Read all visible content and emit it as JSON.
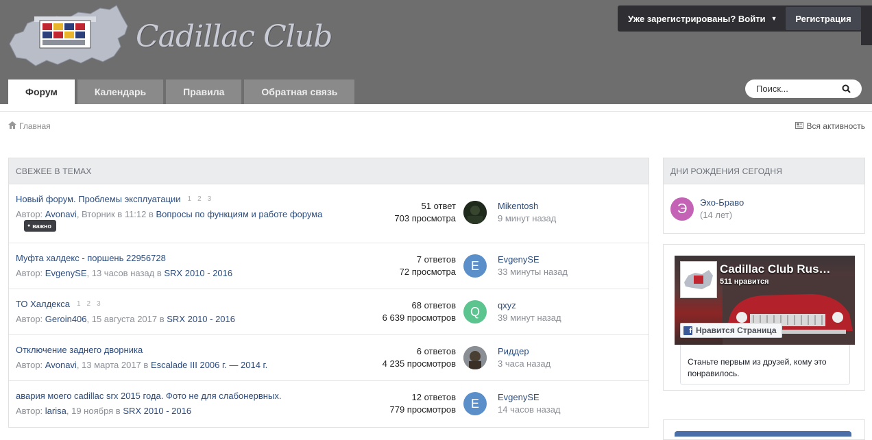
{
  "header": {
    "logo_text": "Cadillac Club",
    "login_label": "Уже зарегистрированы? Войти",
    "register_label": "Регистрация",
    "search_placeholder": "Поиск..."
  },
  "nav": {
    "tabs": [
      {
        "label": "Форум",
        "active": true
      },
      {
        "label": "Календарь",
        "active": false
      },
      {
        "label": "Правила",
        "active": false
      },
      {
        "label": "Обратная связь",
        "active": false
      }
    ]
  },
  "breadcrumb": {
    "home_label": "Главная",
    "activity_label": "Вся активность"
  },
  "topics": {
    "header": "СВЕЖЕЕ В ТЕМАХ",
    "rows": [
      {
        "title": "Новый форум. Проблемы эксплуатации",
        "pages": [
          "1",
          "2",
          "3"
        ],
        "author_prefix": "Автор:",
        "author": "Avonavi",
        "date_text": ", Вторник в 11:12 в",
        "forum": "Вопросы по функциям и работе форума",
        "badge": "важно",
        "replies": "51 ответ",
        "views": "703 просмотра",
        "last_user": "Mikentosh",
        "last_time": "9 минут назад",
        "avatar_letter": "",
        "avatar_color": "#1f2a1c"
      },
      {
        "title": "Муфта халдекс - поршень 22956728",
        "pages": [],
        "author_prefix": "Автор:",
        "author": "EvgenySE",
        "date_text": ", 13 часов назад в",
        "forum": "SRX 2010 - 2016",
        "badge": "",
        "replies": "7 ответов",
        "views": "72 просмотра",
        "last_user": "EvgenySE",
        "last_time": "33 минуты назад",
        "avatar_letter": "E",
        "avatar_color": "#5b8fc9"
      },
      {
        "title": "ТО Халдекса",
        "pages": [
          "1",
          "2",
          "3"
        ],
        "author_prefix": "Автор:",
        "author": "Geroin406",
        "date_text": ", 15 августа 2017 в",
        "forum": "SRX 2010 - 2016",
        "badge": "",
        "replies": "68 ответов",
        "views": "6 639 просмотров",
        "last_user": "qxyz",
        "last_time": "39 минут назад",
        "avatar_letter": "Q",
        "avatar_color": "#5cc48f"
      },
      {
        "title": "Отключение заднего дворника",
        "pages": [],
        "author_prefix": "Автор:",
        "author": "Avonavi",
        "date_text": ", 13 марта 2017 в",
        "forum": "Escalade III 2006 г. — 2014 г.",
        "badge": "",
        "replies": "6 ответов",
        "views": "4 235 просмотров",
        "last_user": "Риддер",
        "last_time": "3 часа назад",
        "avatar_letter": "",
        "avatar_color": "#6b6056"
      },
      {
        "title": "авария моего cadillac srx 2015 года. Фото не для слабонервных.",
        "pages": [],
        "author_prefix": "Автор:",
        "author": "larisa",
        "date_text": ", 19 ноября в",
        "forum": "SRX 2010 - 2016",
        "badge": "",
        "replies": "12 ответов",
        "views": "779 просмотров",
        "last_user": "EvgenySE",
        "last_time": "14 часов назад",
        "avatar_letter": "E",
        "avatar_color": "#5b8fc9"
      }
    ]
  },
  "birthdays": {
    "header": "ДНИ РОЖДЕНИЯ СЕГОДНЯ",
    "name": "Эхо-Браво",
    "age": "(14 лет)",
    "avatar_letter": "Э"
  },
  "facebook": {
    "page_name": "Cadillac Club Rus…",
    "likes": "511 нравится",
    "like_button": "Нравится Страница",
    "friends_text": "Станьте первым из друзей, кому это понравилось."
  }
}
